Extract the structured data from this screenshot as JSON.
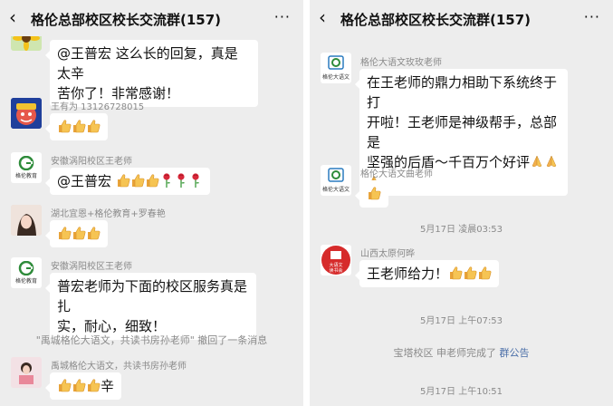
{
  "header": {
    "back_icon": "‹",
    "title": "格伦总部校区校长交流群(157)",
    "more_icon": "···"
  },
  "left": {
    "top_partial": {
      "text": "@王普宏  这么长的回复，真是太辛\n苦你了！非常感谢！"
    },
    "msg1": {
      "sender": "王有为  13126728015"
    },
    "msg2": {
      "sender": "安徽涡阳校区王老师",
      "avatar_text": "格伦教育",
      "prefix": "@王普宏 "
    },
    "msg3": {
      "sender": "湖北宜恩+格伦教育+罗春艳"
    },
    "msg4": {
      "sender": "安徽涡阳校区王老师",
      "avatar_text": "格伦教育",
      "text": "普宏老师为下面的校区服务真是扎\n实，耐心，细致！"
    },
    "recall": "\"禹城格伦大语文，共读书房孙老师\" 撤回了一条消息",
    "msg5": {
      "sender": "禹城格伦大语文，共读书房孙老师",
      "suffix": "辛"
    }
  },
  "right": {
    "msg1": {
      "sender": "格伦大语文玫玫老师",
      "avatar_text": "格伦大语文",
      "text": "在王老师的鼎力相助下系统终于打\n开啦！王老师是神级帮手，总部是\n坚强的后盾～千百万个好评"
    },
    "msg2": {
      "sender": "格伦大语文曲老师",
      "avatar_text": "格伦大语文"
    },
    "time1": "5月17日 凌晨03:53",
    "msg3": {
      "sender": "山西太原何晔",
      "avatar_text": "大语文\n读书会",
      "text": "王老师给力！"
    },
    "time2": "5月17日 上午07:53",
    "sys": {
      "text": "宝塔校区  申老师完成了",
      "link": "群公告"
    },
    "time3": "5月17日 上午10:51"
  },
  "colors": {
    "background": "#ededed",
    "bubble": "#ffffff",
    "meta": "#8a8a8a",
    "link": "#4a6ea8"
  }
}
